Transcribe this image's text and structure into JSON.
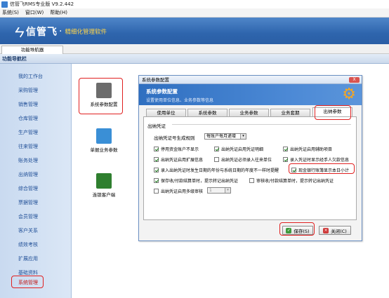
{
  "window": {
    "title": "信管飞RMS专业版 V9.2.442"
  },
  "menu": {
    "items": [
      "系统(S)",
      "窗口(W)",
      "帮助(H)"
    ]
  },
  "banner": {
    "logo_name": "信管飞",
    "tagline": "精细化管理软件"
  },
  "nav": {
    "tab": "功能导航器",
    "header": "功能导航栏",
    "items": [
      "我的工作台",
      "采购管理",
      "销售管理",
      "仓库管理",
      "生产管理",
      "往来管理",
      "账务处理",
      "出纳管理",
      "综合管理",
      "票据管理",
      "会员管理",
      "客户关系",
      "绩效考核",
      "扩展应用",
      "基础资料",
      "系统管理"
    ]
  },
  "quick": {
    "items": [
      {
        "label": "系统参数配置",
        "icon": "system-config-icon",
        "color": "#5a5a5a"
      },
      {
        "label": "单据业务参数",
        "icon": "document-params-icon",
        "color": "#3a8fd6"
      },
      {
        "label": "连锁客户端",
        "icon": "chain-client-icon",
        "color": "#2f7f2f"
      }
    ]
  },
  "dialog": {
    "title": "系统参数配置",
    "close_label": "X",
    "header_title": "系统参数配置",
    "header_subtitle": "设置使用单位信息、业务参数等信息",
    "tabs": [
      "使用单位",
      "系统参数",
      "业务参数",
      "业务套期",
      "出纳参数"
    ],
    "active_tab": "出纳参数",
    "group_title": "出纳凭证",
    "rule_label": "出纳凭证号生成规则",
    "rule_value": "每账户每月递增",
    "checkboxes": [
      {
        "label": "停用资金账户不显示",
        "checked": true
      },
      {
        "label": "出纳凭证启用凭证明细",
        "checked": true
      },
      {
        "label": "出纳凭证启用辅助项目",
        "checked": true
      },
      {
        "label": "出纳凭证启用扩展信息",
        "checked": true
      },
      {
        "label": "出纳凭证必须录入往来单位",
        "checked": false
      },
      {
        "label": "录入凭证时显示经手人欠款信息",
        "checked": true
      },
      {
        "label": "录入出纳凭证时发生日期的年份与系统日期的年度不一样时提醒",
        "checked": true
      },
      {
        "label": "现金银行账簿显示本日小计",
        "checked": true
      },
      {
        "label": "保存收/付款结算单时，提示转记出纳凭证",
        "checked": true
      },
      {
        "label": "审核收/付款结算单时，提示转记出纳凭证",
        "checked": false
      },
      {
        "label": "出纳凭证启用多级审核",
        "checked": false
      }
    ],
    "approval_value": "1",
    "save_label": "保存(S)",
    "close_btn_label": "关闭(C)"
  },
  "colors": {
    "banner": "#2e65ad",
    "sidebar_text": "#1f4e96",
    "highlight": "#e02020",
    "gear": "#f5a623"
  }
}
